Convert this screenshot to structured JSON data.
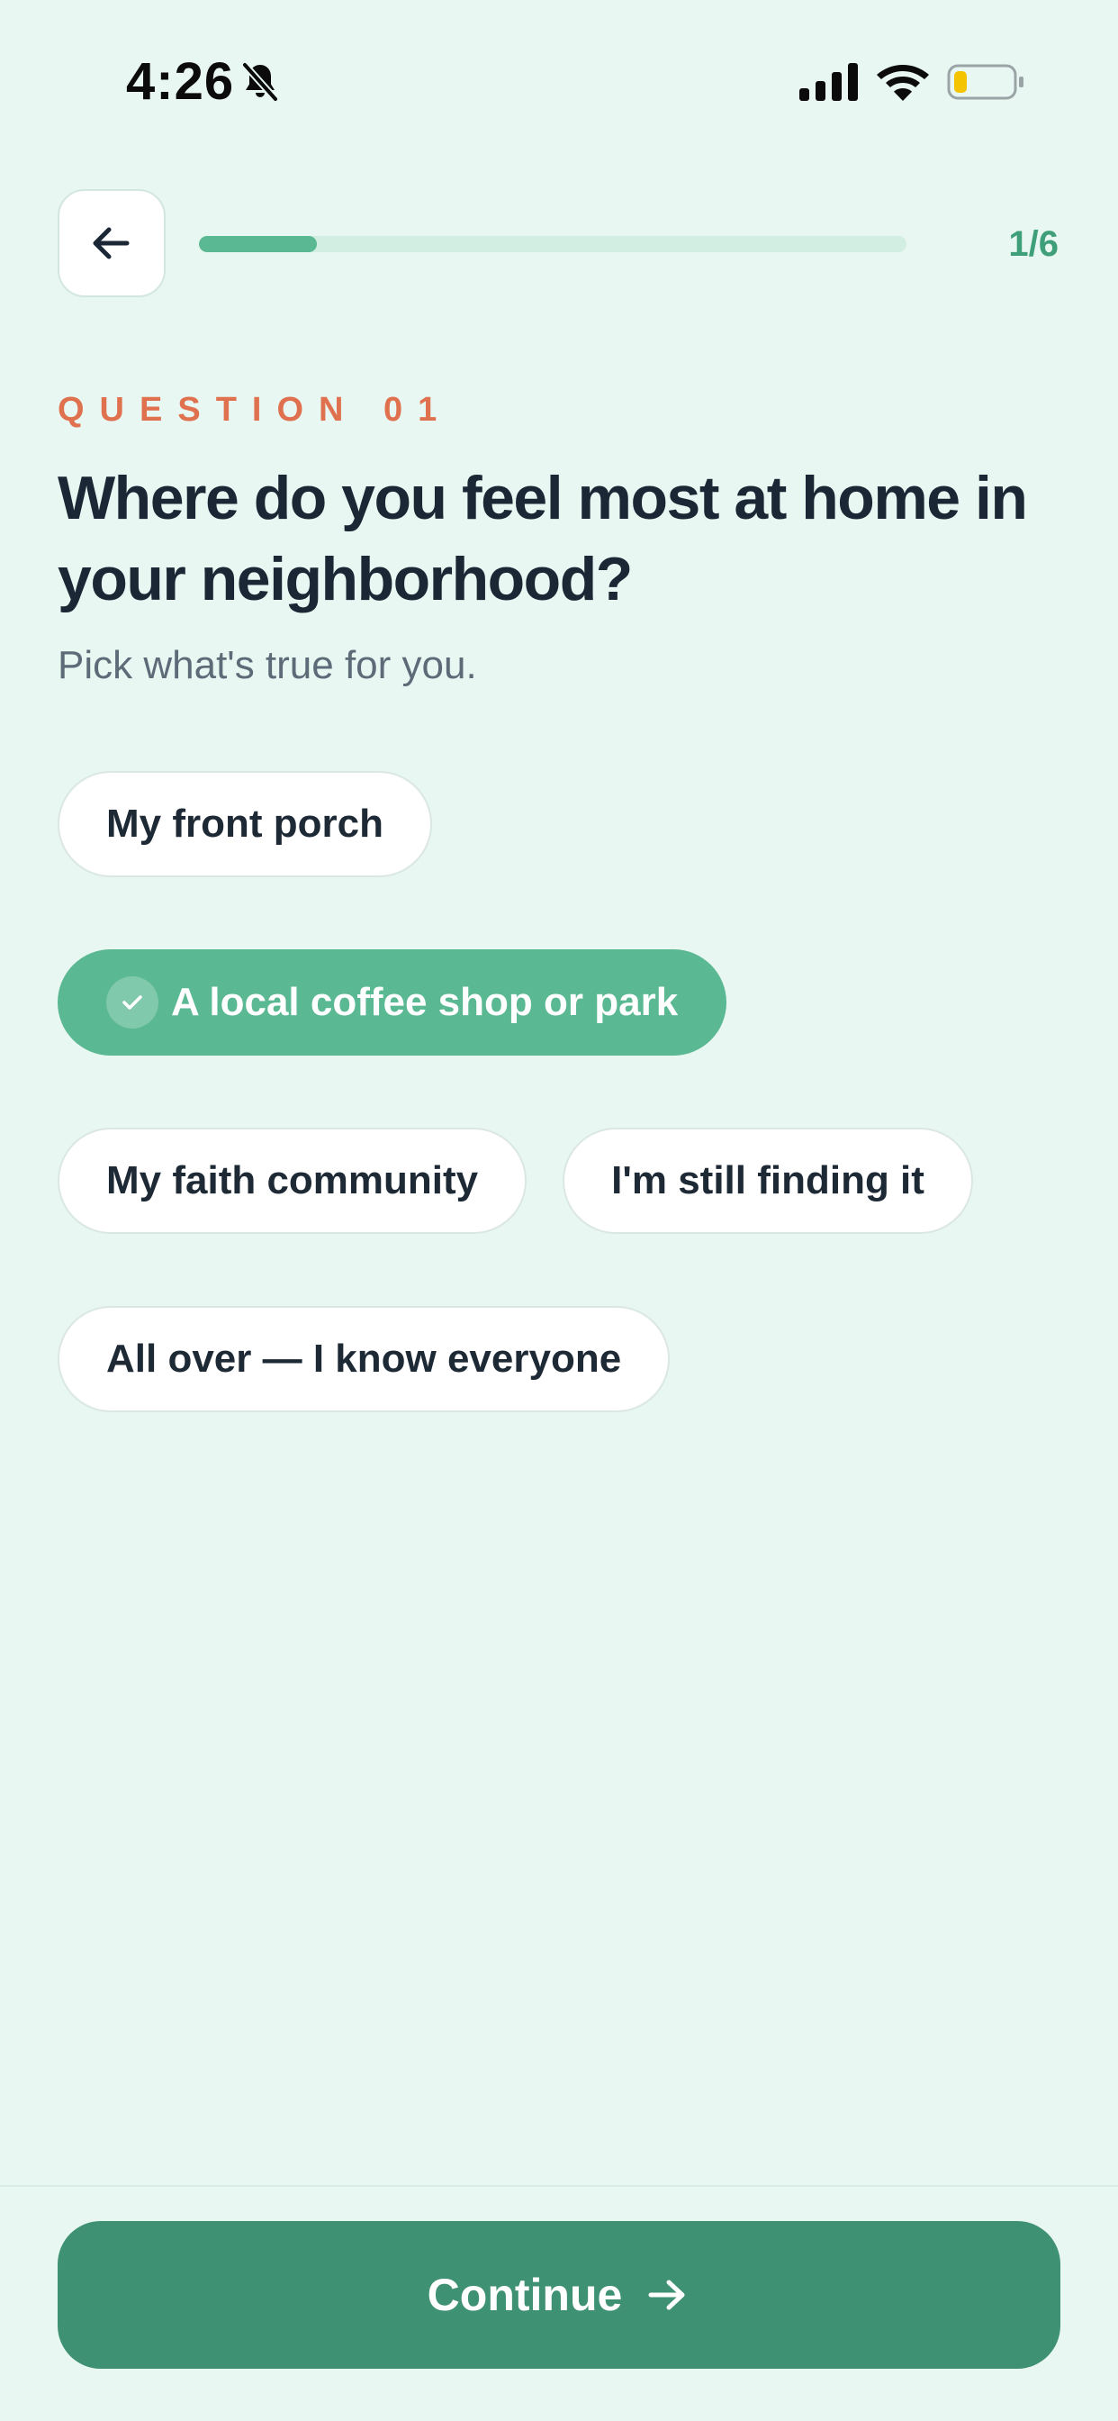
{
  "status_bar": {
    "time": "4:26",
    "icons": [
      "bell-off-icon",
      "signal-icon",
      "wifi-icon",
      "battery-icon"
    ],
    "battery_color": "#f4c400"
  },
  "header": {
    "back_icon": "arrow-left-icon",
    "progress": {
      "current": 1,
      "total": 6,
      "fraction": 0.167,
      "label": "1/6"
    }
  },
  "question": {
    "eyebrow": "QUESTION 01",
    "title": "Where do you feel most at home in your neighborhood?",
    "subtitle": "Pick what's true for you."
  },
  "options": [
    {
      "label": "My front porch",
      "selected": false
    },
    {
      "label": "A local coffee shop or park",
      "selected": true
    },
    {
      "label": "My faith community",
      "selected": false
    },
    {
      "label": "I'm still finding it",
      "selected": false
    },
    {
      "label": "All over — I know everyone",
      "selected": false
    }
  ],
  "footer": {
    "continue_label": "Continue",
    "continue_icon": "arrow-right-icon"
  },
  "colors": {
    "background": "#e8f7f1",
    "accent": "#5ab893",
    "primary_button": "#3f9173",
    "eyebrow": "#e0714f",
    "title": "#1b2735"
  }
}
